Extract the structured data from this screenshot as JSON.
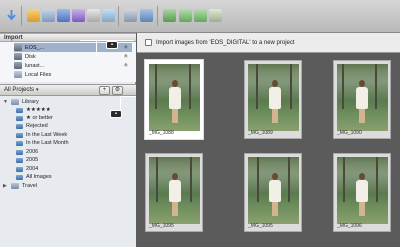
{
  "toolbar": {
    "icons": [
      "import-arrow-icon",
      "new-folder-icon",
      "new-project-icon",
      "new-album-icon",
      "new-smart-album-icon",
      "new-book-icon",
      "new-webpage-icon",
      "vault-icon",
      "email-icon",
      "print-icon",
      "rotate-left-icon",
      "rotate-right-icon",
      "adjust-icon"
    ]
  },
  "import_panel": {
    "title": "Import",
    "items": [
      {
        "label": "EOS_...",
        "icon": "camera-icon",
        "selected": true
      },
      {
        "label": "Disk",
        "icon": "disk-icon",
        "selected": false
      },
      {
        "label": "lunast...",
        "icon": "disk-icon",
        "selected": false
      },
      {
        "label": "Local Files",
        "icon": "local-files-icon",
        "selected": false
      }
    ],
    "eject_symbol": "≙"
  },
  "projects": {
    "selector_label": "All Projects",
    "add_symbol": "+",
    "action_symbol": "⚙",
    "tree": [
      {
        "label": "Library",
        "type": "folder",
        "level": 0,
        "expanded": true
      },
      {
        "label": "★★★★★",
        "type": "album",
        "level": 1
      },
      {
        "label": "★ or better",
        "type": "album",
        "level": 1
      },
      {
        "label": "Rejected",
        "type": "album",
        "level": 1
      },
      {
        "label": "In the Last Week",
        "type": "album",
        "level": 1
      },
      {
        "label": "In the Last Month",
        "type": "album",
        "level": 1
      },
      {
        "label": "2006",
        "type": "album",
        "level": 1
      },
      {
        "label": "2005",
        "type": "album",
        "level": 1
      },
      {
        "label": "2004",
        "type": "album",
        "level": 1
      },
      {
        "label": "All Images",
        "type": "album",
        "level": 1
      },
      {
        "label": "Travel",
        "type": "folder",
        "level": 0,
        "expanded": false
      }
    ]
  },
  "callouts": {
    "a": "▪",
    "b": "▪"
  },
  "main": {
    "import_checkbox_label": "Import images from 'EOS_DIGITAL' to a new project",
    "thumbnails": [
      {
        "label": "_MG_1088",
        "selected": true
      },
      {
        "label": "_MG_1089",
        "selected": false
      },
      {
        "label": "_MG_1090",
        "selected": false
      },
      {
        "label": "_MG_1095",
        "selected": false
      },
      {
        "label": "_MG_1095",
        "selected": false
      },
      {
        "label": "_MG_1096",
        "selected": false
      }
    ]
  }
}
